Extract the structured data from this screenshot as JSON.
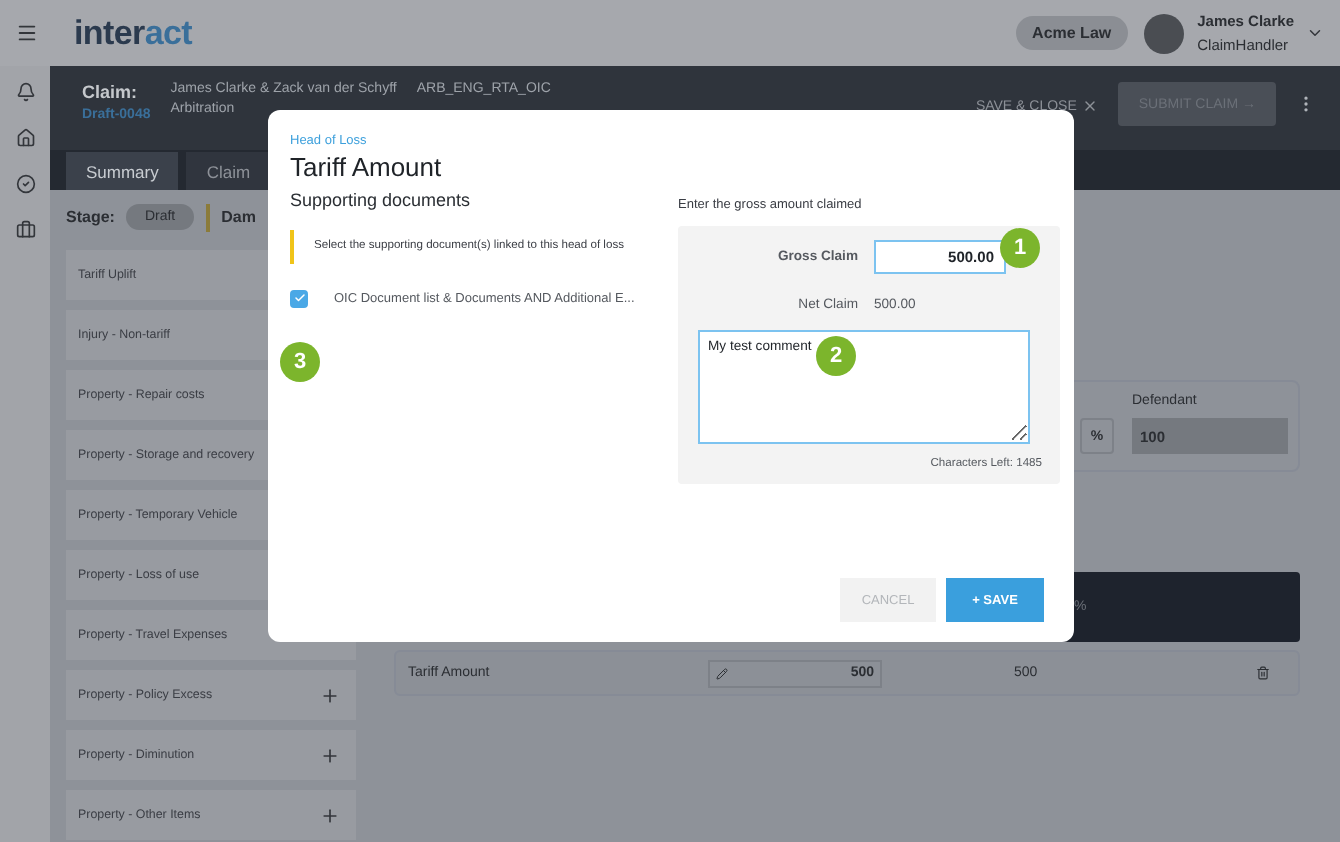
{
  "topbar": {
    "logo": {
      "main": "inter",
      "accent": "act"
    },
    "org": "Acme Law",
    "user": {
      "name": "James Clarke",
      "role": "ClaimHandler"
    }
  },
  "rail": {
    "items": [
      {
        "kind": "bell"
      },
      {
        "kind": "home"
      },
      {
        "kind": "check"
      },
      {
        "kind": "briefcase"
      }
    ]
  },
  "claim": {
    "label": "Claim:",
    "id": "Draft-0048",
    "parties": "James Clarke & Zack van der Schyff",
    "type": "Arbitration",
    "code": "ARB_ENG_RTA_OIC",
    "save_close": "SAVE & CLOSE",
    "submit": "SUBMIT CLAIM →"
  },
  "tabs": [
    {
      "label": "Summary",
      "selected": true
    },
    {
      "label": "Claim",
      "selected": false
    }
  ],
  "stage": {
    "label": "Stage:",
    "value": "Draft",
    "section": "Dam"
  },
  "heads": [
    {
      "label": "Tariff Uplift",
      "add": false
    },
    {
      "label": "Injury - Non-tariff",
      "add": false
    },
    {
      "label": "Property - Repair costs",
      "add": false
    },
    {
      "label": "Property - Storage and recovery",
      "add": false
    },
    {
      "label": "Property - Temporary Vehicle",
      "add": false
    },
    {
      "label": "Property - Loss of use",
      "add": false
    },
    {
      "label": "Property - Travel Expenses",
      "add": false
    },
    {
      "label": "Property - Policy Excess",
      "add": true
    },
    {
      "label": "Property - Diminution",
      "add": true
    },
    {
      "label": "Property - Other Items",
      "add": true
    }
  ],
  "split": {
    "defendant_label": "Defendant",
    "unit": "%",
    "defendant_value": "100"
  },
  "summary_bar": {
    "unit": "%"
  },
  "row": {
    "name": "Tariff Amount",
    "value": "500",
    "net": "500"
  },
  "modal": {
    "eyebrow": "Head of Loss",
    "title": "Tariff Amount",
    "docs_heading": "Supporting documents",
    "note": "Select the supporting document(s) linked to this head of loss",
    "documents": [
      {
        "label": "OIC Document list & Documents AND Additional E...",
        "checked": true
      }
    ],
    "prompt": "Enter the gross amount claimed",
    "gross_label": "Gross Claim",
    "gross_value": "500.00",
    "net_label": "Net Claim",
    "net_value": "500.00",
    "comment": "My test comment",
    "chars_left": "Characters Left: 1485",
    "cancel": "CANCEL",
    "save": "+ SAVE",
    "badges": [
      "1",
      "2",
      "3"
    ]
  }
}
